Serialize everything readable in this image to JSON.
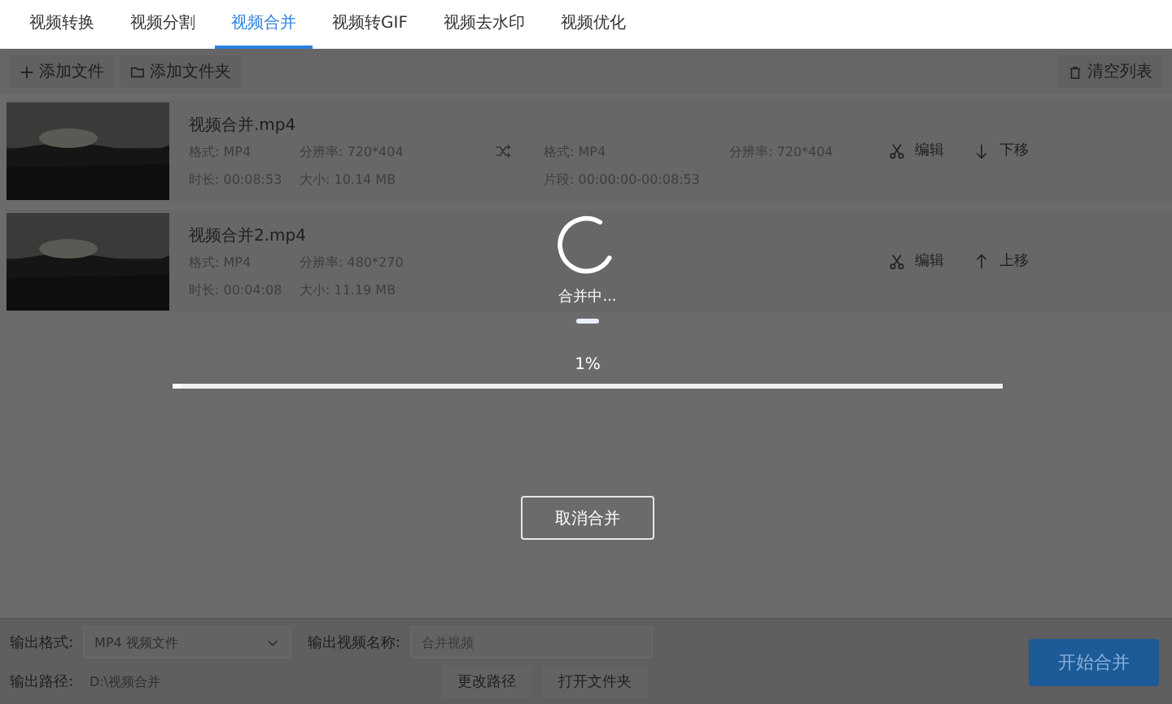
{
  "tabs": [
    {
      "label": "视频转换",
      "selected": false
    },
    {
      "label": "视频分割",
      "selected": false
    },
    {
      "label": "视频合并",
      "selected": true
    },
    {
      "label": "视频转GIF",
      "selected": false
    },
    {
      "label": "视频去水印",
      "selected": false
    },
    {
      "label": "视频优化",
      "selected": false
    }
  ],
  "toolbar": {
    "add_file": "添加文件",
    "add_folder": "添加文件夹",
    "clear_list": "清空列表"
  },
  "files": [
    {
      "name": "视频合并.mp4",
      "thumbnail": {
        "kind": "picture"
      },
      "source": [
        "格式: MP4",
        "分辨率: 720*404",
        "时长: 00:08:53",
        "大小: 10.14 MB"
      ],
      "output": [
        "格式: MP4",
        "分辨率: 720*404",
        "片段: 00:00:00-00:08:53"
      ],
      "edit": "编辑",
      "move": "下移",
      "kind": "down"
    },
    {
      "name": "视频合并2.mp4",
      "thumbnail": {
        "kind": "picture"
      },
      "source": [
        "格式: MP4",
        "分辨率: 480*270",
        "时长: 00:04:08",
        "大小: 11.19 MB"
      ],
      "edit": "编辑",
      "move": "上移",
      "kind": "up"
    }
  ],
  "progress_dialog": {
    "status": "合并中...",
    "percent": "1%",
    "level": 0.01,
    "cancel": "取消合并"
  },
  "output": {
    "format_label": "输出格式:",
    "format": "MP4  视频文件",
    "name_label": "输出视频名称:",
    "name_placeholder": "合并视频",
    "path_label": "输出路径:",
    "path": "D:\\视频合并",
    "change_path": "更改路径",
    "open_folder": "打开文件夹",
    "start": "开始合并"
  }
}
